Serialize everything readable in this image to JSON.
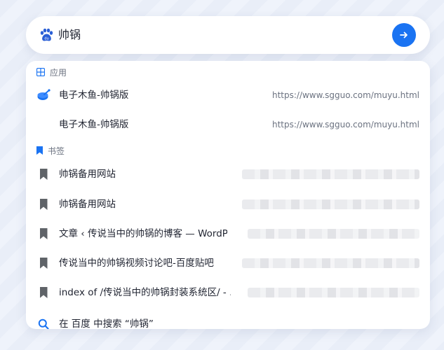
{
  "search": {
    "engine_icon": "paw-icon",
    "query": "帅锅",
    "go_icon": "arrow-right-icon",
    "accent_color": "#1a73f2"
  },
  "sections": {
    "apps": {
      "icon": "grid-icon",
      "label": "应用"
    },
    "bookmarks": {
      "icon": "bookmark-icon",
      "label": "书签"
    }
  },
  "app_items": [
    {
      "icon": "drum-icon",
      "title": "电子木鱼-帅锅版",
      "url": "https://www.sgguo.com/muyu.html"
    },
    {
      "icon": "",
      "title": "电子木鱼-帅锅版",
      "url": "https://www.sgguo.com/muyu.html"
    }
  ],
  "bookmark_items": [
    {
      "icon": "bookmark-icon",
      "title": "帅锅备用网站"
    },
    {
      "icon": "bookmark-icon",
      "title": "帅锅备用网站"
    },
    {
      "icon": "bookmark-icon",
      "title": "文章 ‹ 传说当中的帅锅的博客 — WordPr"
    },
    {
      "icon": "bookmark-icon",
      "title": "传说当中的帅锅视频讨论吧-百度贴吧"
    },
    {
      "icon": "bookmark-icon",
      "title": "index of /传说当中的帅锅封装系统区/ - ."
    }
  ],
  "web_search": {
    "icon": "search-icon",
    "label": "在 百度 中搜索 “帅锅”"
  }
}
